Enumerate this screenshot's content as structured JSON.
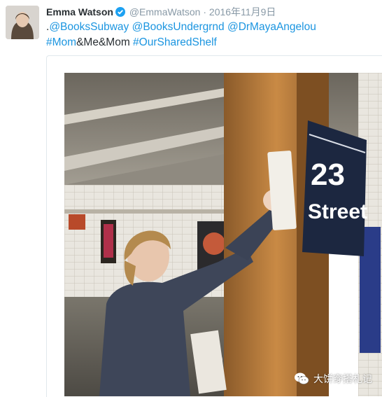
{
  "tweet": {
    "author_name": "Emma Watson",
    "handle": "@EmmaWatson",
    "separator": "·",
    "date": "2016年11月9日",
    "text_line1": [
      {
        "t": ".",
        "link": false
      },
      {
        "t": "@BooksSubway",
        "link": true
      },
      {
        "t": " ",
        "link": false
      },
      {
        "t": "@BooksUndergrnd",
        "link": true
      },
      {
        "t": " ",
        "link": false
      },
      {
        "t": "@DrMayaAngelou",
        "link": true
      }
    ],
    "text_line2": [
      {
        "t": "#Mom",
        "link": true
      },
      {
        "t": "&Me&Mom",
        "link": false
      },
      {
        "t": " ",
        "link": false
      },
      {
        "t": "#OurSharedShelf",
        "link": true
      }
    ]
  },
  "photo": {
    "sign_number": "23",
    "sign_street": "Street",
    "watermark": "大饼穿搭札记",
    "watermark_icon": "wechat-icon"
  },
  "colors": {
    "link": "#1b95e0",
    "text": "#292f33",
    "meta": "#8899a6",
    "verified": "#1da1f2"
  }
}
